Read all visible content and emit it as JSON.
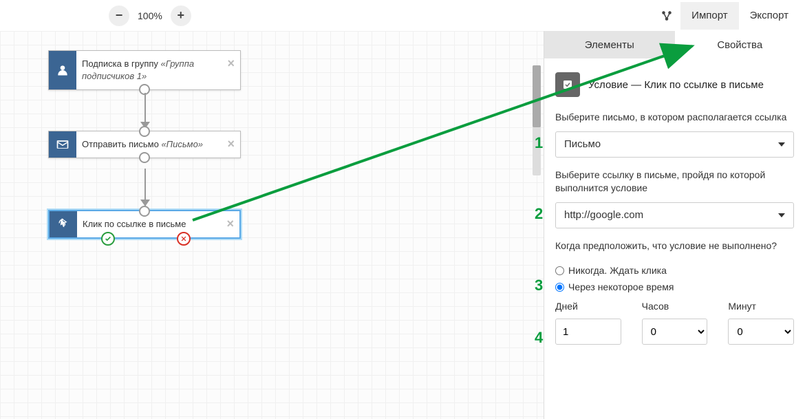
{
  "topbar": {
    "zoom_level": "100%",
    "import_label": "Импорт",
    "export_label": "Экспорт"
  },
  "nodes": {
    "n1": {
      "prefix": "Подписка в группу ",
      "italic": "«Группа подписчиков 1»"
    },
    "n2": {
      "prefix": "Отправить письмо ",
      "italic": "«Письмо»"
    },
    "n3": {
      "label": "Клик по ссылке в письме"
    }
  },
  "sidebar": {
    "tabs": {
      "elements": "Элементы",
      "properties": "Свойства"
    },
    "header_title": "Условие — Клик по ссылке в письме",
    "field1_label": "Выберите письмо, в котором располагается ссылка",
    "field1_value": "Письмо",
    "field2_label": "Выберите ссылку в письме, пройдя по которой выполнится условие",
    "field2_value": "http://google.com",
    "field3_label": "Когда предположить, что условие не выполнено?",
    "radio1_label": "Никогда. Ждать клика",
    "radio2_label": "Через некоторое время",
    "time_days_label": "Дней",
    "time_days_value": "1",
    "time_hours_label": "Часов",
    "time_hours_value": "0",
    "time_mins_label": "Минут",
    "time_mins_value": "0"
  },
  "annotations": {
    "n1": "1",
    "n2": "2",
    "n3": "3",
    "n4": "4"
  }
}
